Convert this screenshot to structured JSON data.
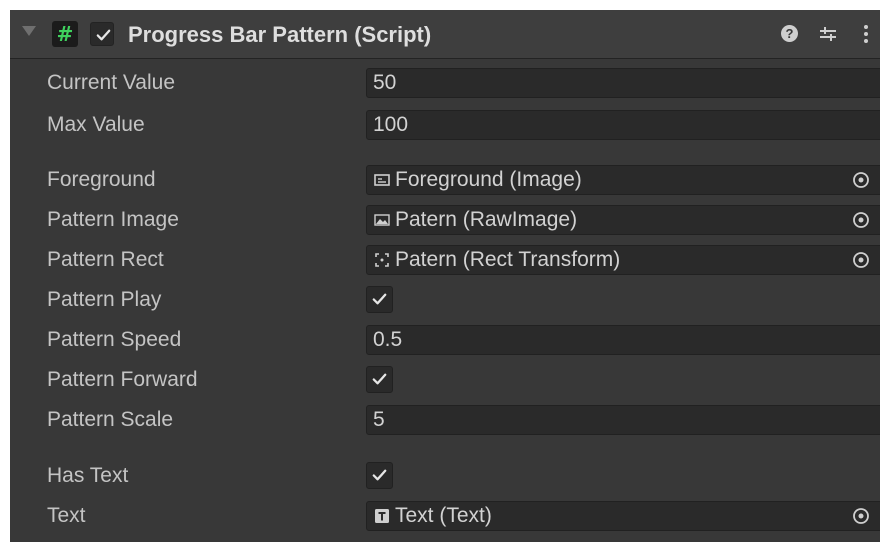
{
  "component": {
    "title": "Progress Bar Pattern (Script)",
    "icon": "csharp-script-icon",
    "enabled": true,
    "header_buttons": [
      "help-icon",
      "presets-icon",
      "context-menu-icon"
    ]
  },
  "fields": [
    {
      "label": "Current Value",
      "type": "number",
      "value": "50"
    },
    {
      "label": "Max Value",
      "type": "number",
      "value": "100"
    },
    {
      "label": "Foreground",
      "type": "object",
      "value": "Foreground (Image)",
      "icon": "image-component-icon"
    },
    {
      "label": "Pattern Image",
      "type": "object",
      "value": "Patern (RawImage)",
      "icon": "raw-image-icon"
    },
    {
      "label": "Pattern Rect",
      "type": "object",
      "value": "Patern (Rect Transform)",
      "icon": "rect-transform-icon"
    },
    {
      "label": "Pattern Play",
      "type": "bool",
      "value": true
    },
    {
      "label": "Pattern Speed",
      "type": "number",
      "value": "0.5"
    },
    {
      "label": "Pattern Forward",
      "type": "bool",
      "value": true
    },
    {
      "label": "Pattern Scale",
      "type": "number",
      "value": "5"
    },
    {
      "label": "Has Text",
      "type": "bool",
      "value": true
    },
    {
      "label": "Text",
      "type": "object",
      "value": "Text (Text)",
      "icon": "text-component-icon"
    }
  ],
  "colors": {
    "background": "#383838",
    "header": "#3e3e3e",
    "field": "#2a2a2a",
    "label_text": "#c4c4c4",
    "script_icon": "#3fd25e"
  }
}
